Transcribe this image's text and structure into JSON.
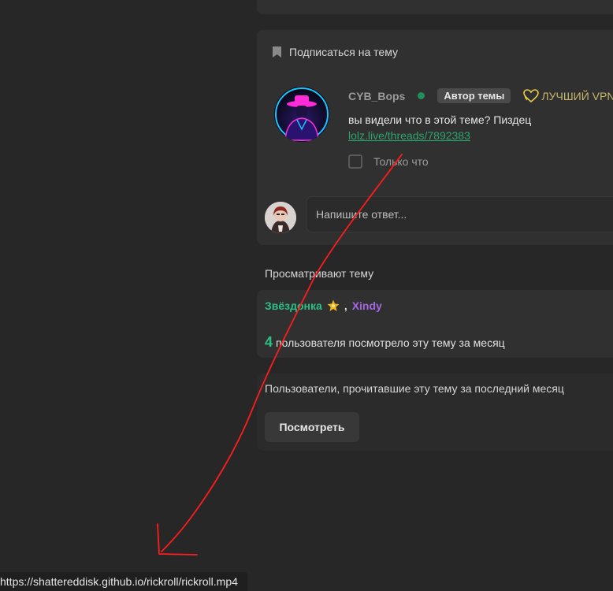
{
  "thread": {
    "subscribe_label": "Подписаться на тему"
  },
  "post": {
    "username": "CYB_Bops",
    "badge": "Автор темы",
    "vpn_label": "ЛУЧШИЙ VPN",
    "message": "вы видели что в этой теме? Пиздец",
    "link": "lolz.live/threads/7892383",
    "only_label": "Только что"
  },
  "reply": {
    "placeholder": "Напишите ответ..."
  },
  "viewers": {
    "title": "Просматривают тему",
    "users": [
      "Звёздонка",
      "Xindy"
    ],
    "separator": ",",
    "month_count": "4",
    "month_text": "пользователя посмотрело эту тему за месяц"
  },
  "readers": {
    "title": "Пользователи, прочитавшие эту тему за последний месяц",
    "button_label": "Посмотреть"
  },
  "status_bar": {
    "url": "https://shattereddisk.github.io/rickroll/rickroll.mp4"
  },
  "colors": {
    "background": "#272727",
    "card": "#303030",
    "accent_green": "#2bbf86",
    "accent_purple": "#a667e6",
    "arrow_red": "#ff1c1c"
  },
  "icons": {
    "subscribe": "bookmark-icon",
    "vpn": "heart-outline-icon",
    "viewer_badge": "star-icon",
    "annotation": "red-arrow"
  }
}
